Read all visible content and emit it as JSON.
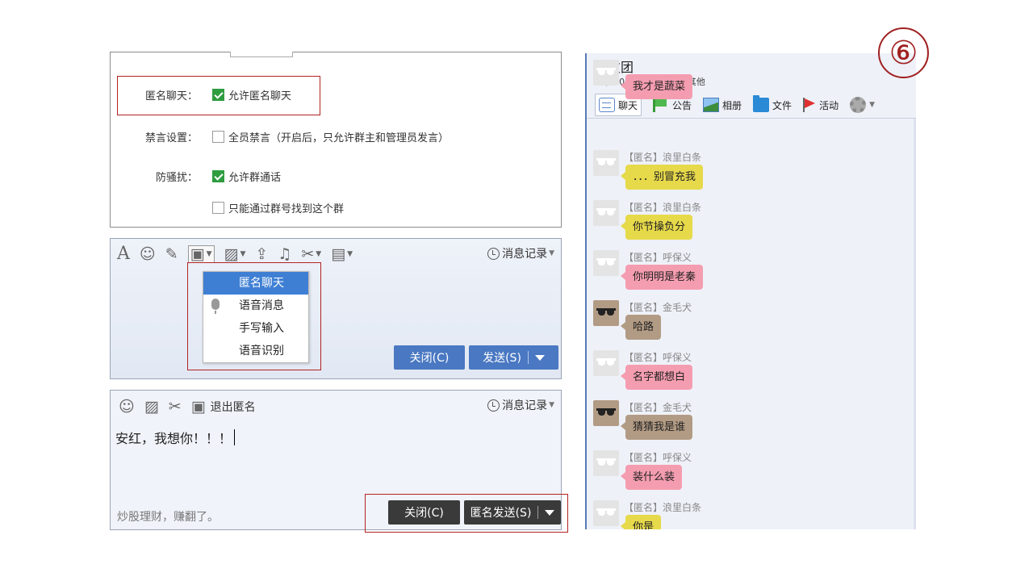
{
  "step_number": "⑥",
  "settings": {
    "anon_label": "匿名聊天：",
    "anon_option": "允许匿名聊天",
    "mute_label": "禁言设置：",
    "mute_option": "全员禁言（开启后，只允许群主和管理员发言）",
    "disturb_label": "防骚扰：",
    "disturb_option1": "允许群通话",
    "disturb_option2": "只能通过群号找到这个群"
  },
  "composer1": {
    "history_label": "消息记录",
    "menu": [
      "匿名聊天",
      "语音消息",
      "手写输入",
      "语音识别"
    ],
    "close_label": "关闭(C)",
    "send_label": "发送(S)"
  },
  "composer2": {
    "exit_anon_label": "退出匿名",
    "history_label": "消息记录",
    "input_value": "安红，我想你！！！",
    "ad_text": "炒股理财，赚翻了。",
    "close_label": "关闭(C)",
    "send_label": "匿名发送(S)"
  },
  "group": {
    "title": "秦友团",
    "subtitle": "(500人群) 兴趣爱好-其他",
    "tabs": [
      "聊天",
      "公告",
      "相册",
      "文件",
      "活动"
    ],
    "messages": [
      {
        "nick": "",
        "text": "我才是蔬菜",
        "color": "#f59db0",
        "avatar": "white"
      },
      {
        "nick": "【匿名】浪里白条",
        "text": "．．．别冒充我",
        "color": "#e6d94a",
        "avatar": "white"
      },
      {
        "nick": "【匿名】浪里白条",
        "text": "你节操负分",
        "color": "#e6d94a",
        "avatar": "white"
      },
      {
        "nick": "【匿名】呼保义",
        "text": "你明明是老秦",
        "color": "#f59db0",
        "avatar": "white"
      },
      {
        "nick": "【匿名】金毛犬",
        "text": "哈路",
        "color": "#b29b84",
        "avatar": "brown"
      },
      {
        "nick": "【匿名】呼保义",
        "text": "名字都想白",
        "color": "#f59db0",
        "avatar": "white"
      },
      {
        "nick": "【匿名】金毛犬",
        "text": "猜猜我是谁",
        "color": "#b29b84",
        "avatar": "brown"
      },
      {
        "nick": "【匿名】呼保义",
        "text": "装什么装",
        "color": "#f59db0",
        "avatar": "white"
      },
      {
        "nick": "【匿名】浪里白条",
        "text": "你是",
        "color": "#e6d94a",
        "avatar": "white"
      }
    ]
  }
}
